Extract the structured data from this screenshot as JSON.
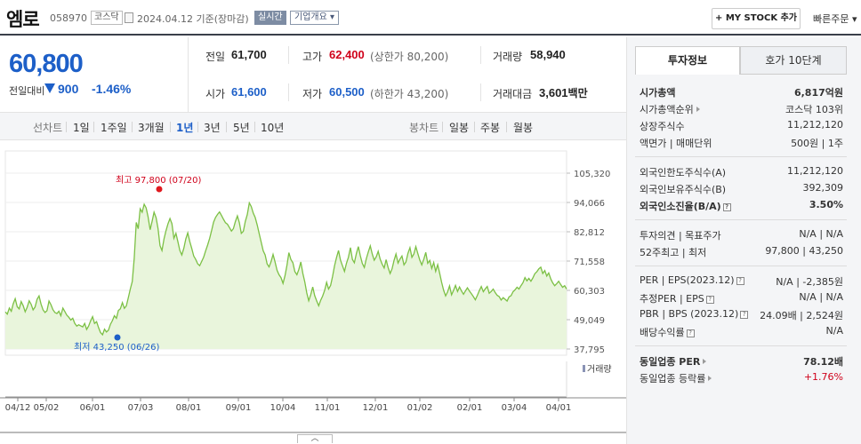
{
  "header": {
    "stock_name": "엠로",
    "stock_code": "058970",
    "market_badge": "코스닥",
    "date_text": "2024.04.12  기준(장마감)",
    "realtime_badge": "실시간",
    "company_badge": "기업개요",
    "mystock_button": "+ MY STOCK 추가",
    "quick_order": "빠른주문"
  },
  "price": {
    "current": "60,800",
    "change_label": "전일대비",
    "change_value": "900",
    "change_percent": "-1.46%",
    "down_color": "#1d5fc8",
    "up_color": "#d0021b"
  },
  "info": {
    "prev_close": {
      "label": "전일",
      "value": "61,700"
    },
    "high": {
      "label": "고가",
      "value": "62,400",
      "sub": "(상한가 80,200)"
    },
    "volume": {
      "label": "거래량",
      "value": "58,940"
    },
    "open": {
      "label": "시가",
      "value": "61,600"
    },
    "low": {
      "label": "저가",
      "value": "60,500",
      "sub": "(하한가 43,200)"
    },
    "amount": {
      "label": "거래대금",
      "value": "3,601",
      "unit": "백만"
    }
  },
  "period_bar": {
    "line_chart_label": "선차트",
    "periods": [
      "1일",
      "1주일",
      "3개월",
      "1년",
      "3년",
      "5년",
      "10년"
    ],
    "selected_period": "1년",
    "candle_chart_label": "봉차트",
    "candle_periods": [
      "일봉",
      "주봉",
      "월봉"
    ]
  },
  "chart_data": {
    "type": "area",
    "y_ticks": [
      "105,320",
      "94,066",
      "82,812",
      "71,558",
      "60,303",
      "49,049",
      "37,795"
    ],
    "ylim": [
      37795,
      105320
    ],
    "x_ticks": [
      "04/12",
      "05/02",
      "06/01",
      "07/03",
      "08/01",
      "09/01",
      "10/04",
      "11/01",
      "12/01",
      "01/02",
      "02/01",
      "03/04",
      "04/01"
    ],
    "high_annotation": "최고 97,800 (07/20)",
    "low_annotation": "최저 43,250 (06/26)",
    "volume_legend": "거래량",
    "line_color": "#7cc045",
    "fill_color": "#e9f5dc",
    "values": [
      52000,
      51200,
      53500,
      52300,
      55200,
      57100,
      54000,
      53200,
      56000,
      54400,
      52100,
      53800,
      56300,
      55000,
      52800,
      53900,
      56900,
      58200,
      55100,
      52800,
      51800,
      52500,
      56200,
      54800,
      52900,
      51800,
      51400,
      52300,
      50600,
      53500,
      52200,
      50800,
      50000,
      48900,
      49600,
      47700,
      46600,
      47100,
      46700,
      46300,
      47600,
      45300,
      46600,
      48600,
      50200,
      47600,
      48300,
      46000,
      44100,
      43250,
      45400,
      44300,
      45000,
      47300,
      48700,
      50600,
      49600,
      52600,
      53200,
      55600,
      53400,
      54300,
      57400,
      60800,
      63700,
      72600,
      86400,
      84000,
      91600,
      90300,
      93400,
      92000,
      88500,
      83600,
      86800,
      90300,
      88200,
      84000,
      77500,
      75600,
      80100,
      83200,
      85800,
      87900,
      85900,
      80300,
      82200,
      79000,
      75600,
      73900,
      76500,
      80100,
      82400,
      79000,
      76400,
      73500,
      72200,
      70500,
      69800,
      71400,
      73100,
      75500,
      77700,
      80300,
      83300,
      86500,
      88300,
      89500,
      90400,
      89100,
      87600,
      86300,
      85700,
      84400,
      83100,
      84000,
      86700,
      88900,
      86300,
      82200,
      83000,
      86800,
      89400,
      93900,
      92500,
      90000,
      88300,
      85400,
      82100,
      78900,
      75500,
      73900,
      70500,
      69300,
      71400,
      74100,
      71300,
      68000,
      66300,
      65200,
      63000,
      65900,
      69900,
      74800,
      72100,
      70900,
      67500,
      66300,
      68400,
      71200,
      66800,
      63500,
      59300,
      56300,
      58700,
      61600,
      58300,
      56200,
      54400,
      56500,
      58100,
      60300,
      63400,
      60800,
      62200,
      65700,
      69700,
      73000,
      75600,
      71900,
      69800,
      67600,
      70700,
      73000,
      76700,
      72200,
      70900,
      74500,
      77100,
      73600,
      70700,
      69100,
      72400,
      75000,
      77400,
      74300,
      71900,
      73200,
      75300,
      72300,
      70400,
      68900,
      72100,
      69100,
      66800,
      68600,
      71800,
      74300,
      70800,
      72300,
      73500,
      70100,
      71200,
      74500,
      76700,
      73000,
      74300,
      77100,
      74400,
      71900,
      70100,
      72300,
      74900,
      70700,
      71800,
      68700,
      71000,
      67600,
      70200,
      66900,
      63400,
      60300,
      58200,
      59700,
      62000,
      58600,
      60300,
      62200,
      59900,
      61600,
      60100,
      58800,
      60100,
      61300,
      60100,
      59000,
      57900,
      56700,
      58400,
      60200,
      61800,
      59800,
      60900,
      61800,
      59200,
      59900,
      60800,
      59500,
      58400,
      57900,
      56600,
      57500,
      56900,
      56200,
      57800,
      58300,
      59800,
      60500,
      61500,
      60800,
      62100,
      63200,
      65200,
      64000,
      64900,
      63800,
      65100,
      66700,
      67500,
      68600,
      69200,
      66800,
      67900,
      65800,
      67000,
      64700,
      63200,
      62100,
      62900,
      63800,
      62600,
      61500,
      62100,
      60800
    ]
  },
  "right_panel": {
    "tabs": [
      "투자정보",
      "호가 10단계"
    ],
    "rows": {
      "market_cap": {
        "label": "시가총액",
        "value": "6,817억원"
      },
      "market_cap_rank": {
        "label": "시가총액순위",
        "value": "코스닥 103위"
      },
      "listed_shares": {
        "label": "상장주식수",
        "value": "11,212,120"
      },
      "par_unit": {
        "label": "액면가 | 매매단위",
        "value": "500원 | 1주"
      },
      "foreign_limit": {
        "label": "외국인한도주식수(A)",
        "value": "11,212,120"
      },
      "foreign_hold": {
        "label": "외국인보유주식수(B)",
        "value": "392,309"
      },
      "foreign_ratio": {
        "label": "외국인소진율(B/A)",
        "value": "3.50%"
      },
      "opinion": {
        "label": "투자의견 | 목표주가",
        "value": "N/A | N/A"
      },
      "week52": {
        "label": "52주최고 | 최저",
        "value": "97,800 | 43,250"
      },
      "per": {
        "label": "PER | EPS(2023.12)",
        "value": "N/A | -2,385원"
      },
      "est_per": {
        "label": "추정PER | EPS",
        "value": "N/A | N/A"
      },
      "pbr": {
        "label": "PBR | BPS (2023.12)",
        "value": "24.09배 | 2,524원"
      },
      "dividend": {
        "label": "배당수익률",
        "value": "N/A"
      },
      "sector_per": {
        "label": "동일업종 PER",
        "value": "78.12배"
      },
      "sector_rate": {
        "label": "동일업종 등락률",
        "value": "+1.76%"
      }
    }
  },
  "footer": {
    "toggle_symbol": "︿"
  }
}
